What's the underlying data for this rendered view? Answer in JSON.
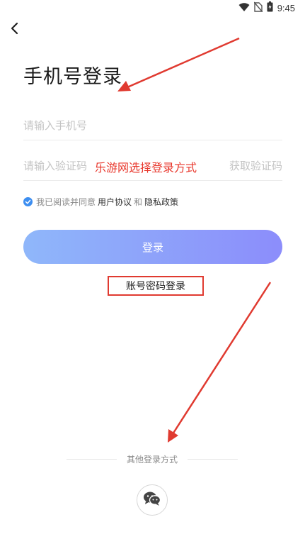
{
  "status_bar": {
    "time": "9:45",
    "icons": [
      "wifi-icon",
      "no-sim-icon",
      "battery-icon"
    ]
  },
  "nav": {
    "back_icon": "chevron-left-icon"
  },
  "page": {
    "title": "手机号登录"
  },
  "form": {
    "phone_placeholder": "请输入手机号",
    "phone_value": "",
    "code_placeholder": "请输入验证码",
    "code_value": "",
    "get_code_label": "获取验证码"
  },
  "agreement": {
    "checked": true,
    "prefix": "我已阅读并同意",
    "user_agreement": "用户协议",
    "and": "和",
    "privacy_policy": "隐私政策"
  },
  "login_button_label": "登录",
  "password_login_label": "账号密码登录",
  "annotation_text": "乐游网选择登录方式",
  "other_login": {
    "label": "其他登录方式",
    "options": [
      "wechat-icon"
    ]
  },
  "colors": {
    "accent_blue": "#3d8ef0",
    "button_gradient_start": "#8fb7fa",
    "button_gradient_end": "#8c8dfb",
    "annotation_red": "#e03a30"
  }
}
